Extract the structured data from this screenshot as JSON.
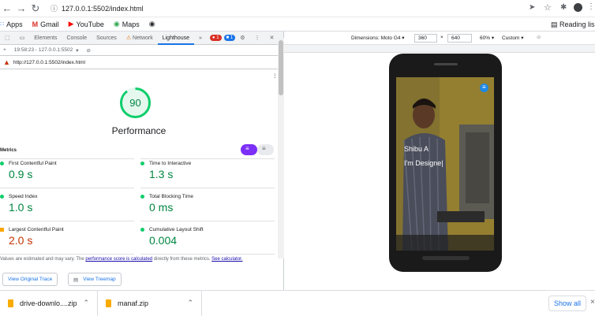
{
  "browser": {
    "url": "127.0.0.1:5502/index.html",
    "reading_list": "Reading lis"
  },
  "bookmarks": [
    {
      "label": "Apps",
      "icon": "apps-grid-icon"
    },
    {
      "label": "Gmail",
      "icon": "gmail-icon"
    },
    {
      "label": "YouTube",
      "icon": "youtube-icon"
    },
    {
      "label": "Maps",
      "icon": "maps-icon"
    }
  ],
  "devtools": {
    "tabs": [
      "Elements",
      "Console",
      "Sources",
      "Network",
      "Lighthouse"
    ],
    "active_tab": "Lighthouse",
    "errors": "1",
    "messages": "1",
    "session": "19:58:23 - 127.0.0.1:5502",
    "report_url": "http://127.0.0.1:5502/index.html"
  },
  "lighthouse": {
    "score": "90",
    "category": "Performance",
    "metrics_title": "Metrics",
    "metrics": [
      {
        "name": "First Contentful Paint",
        "value": "0.9 s",
        "status": "pass"
      },
      {
        "name": "Time to Interactive",
        "value": "1.3 s",
        "status": "pass"
      },
      {
        "name": "Speed Index",
        "value": "1.0 s",
        "status": "pass"
      },
      {
        "name": "Total Blocking Time",
        "value": "0 ms",
        "status": "pass"
      },
      {
        "name": "Largest Contentful Paint",
        "value": "2.0 s",
        "status": "average"
      },
      {
        "name": "Cumulative Layout Shift",
        "value": "0.004",
        "status": "pass"
      }
    ],
    "note_prefix": "Values are estimated and may vary. The",
    "note_link": "performance score is calculated",
    "note_middle": "directly from these metrics.",
    "note_link2": "See calculator.",
    "btn_trace": "View Original Trace",
    "btn_treemap": "View Treemap",
    "colors": {
      "pass": "#0cce6b",
      "pass_text": "#018642",
      "average": "#ffa400",
      "average_text": "#c33300"
    }
  },
  "device_toolbar": {
    "dimensions_label": "Dimensions: Moto G4",
    "width": "360",
    "height": "640",
    "zoom": "60%",
    "throttle": "Custom"
  },
  "preview": {
    "name": "Shibu A",
    "role": "I'm Designe|"
  },
  "downloads": {
    "items": [
      "drive-downlo....zip",
      "manaf.zip"
    ],
    "show_all": "Show all"
  }
}
